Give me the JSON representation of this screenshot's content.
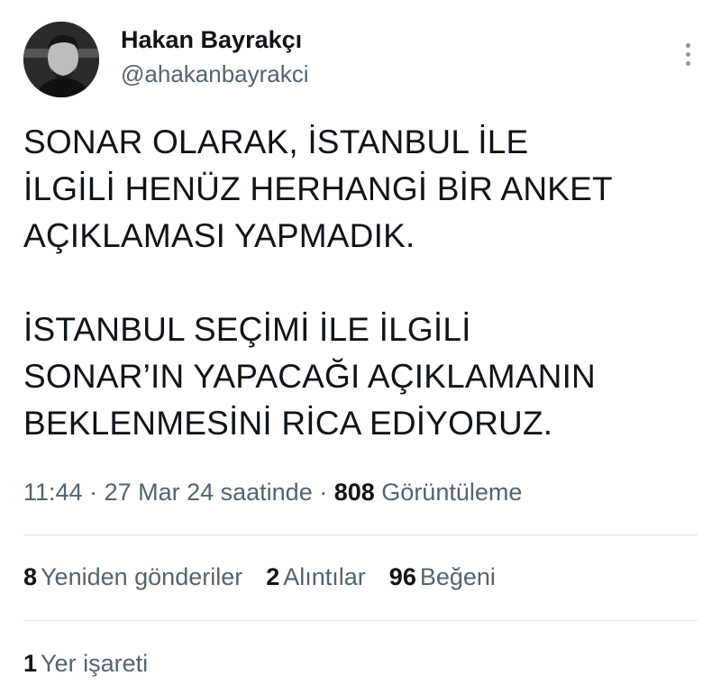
{
  "author": {
    "display_name": "Hakan Bayrakçı",
    "handle": "@ahakanbayrakci",
    "avatar_icon": "profile-photo"
  },
  "more_icon": "more-vertical-icon",
  "body": {
    "paragraph1": [
      "SONAR OLARAK, İSTANBUL İLE",
      "İLGİLİ HENÜZ HERHANGİ BİR ANKET",
      "AÇIKLAMASI YAPMADIK."
    ],
    "paragraph2": [
      "İSTANBUL SEÇİMİ İLE İLGİLİ",
      "SONAR’IN YAPACAĞI AÇIKLAMANIN",
      "BEKLENMESİNİ RİCA EDİYORUZ."
    ]
  },
  "meta": {
    "time": "11:44",
    "separator": " · ",
    "date": "27 Mar 24 saatinde",
    "views_count": "808",
    "views_label": "Görüntüleme"
  },
  "stats": {
    "reposts_count": "8",
    "reposts_label": "Yeniden gönderiler",
    "quotes_count": "2",
    "quotes_label": "Alıntılar",
    "likes_count": "96",
    "likes_label": "Beğeni"
  },
  "bookmarks": {
    "count": "1",
    "label": "Yer işareti"
  },
  "colors": {
    "text_primary": "#0f1419",
    "text_secondary": "#536471",
    "divider": "#e1e8ed"
  }
}
